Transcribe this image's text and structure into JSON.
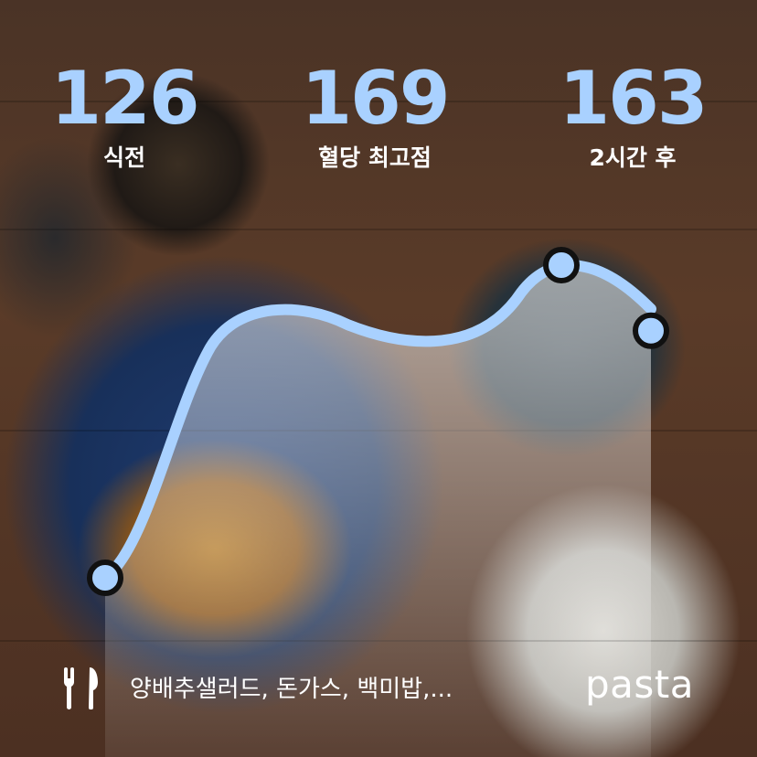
{
  "stats": [
    {
      "value": "126",
      "label": "식전"
    },
    {
      "value": "169",
      "label": "혈당 최고점"
    },
    {
      "value": "163",
      "label": "2시간 후"
    }
  ],
  "meal": {
    "items_text": "양배추샐러드, 돈가스, 백미밥,...",
    "icon": "fork-knife-icon"
  },
  "brand": "pasta",
  "colors": {
    "accent": "#a9d1ff",
    "text": "#ffffff",
    "marker_outline": "#111111"
  },
  "chart_data": {
    "type": "line",
    "series": [
      {
        "values": [
          126,
          169,
          163
        ]
      }
    ]
  }
}
